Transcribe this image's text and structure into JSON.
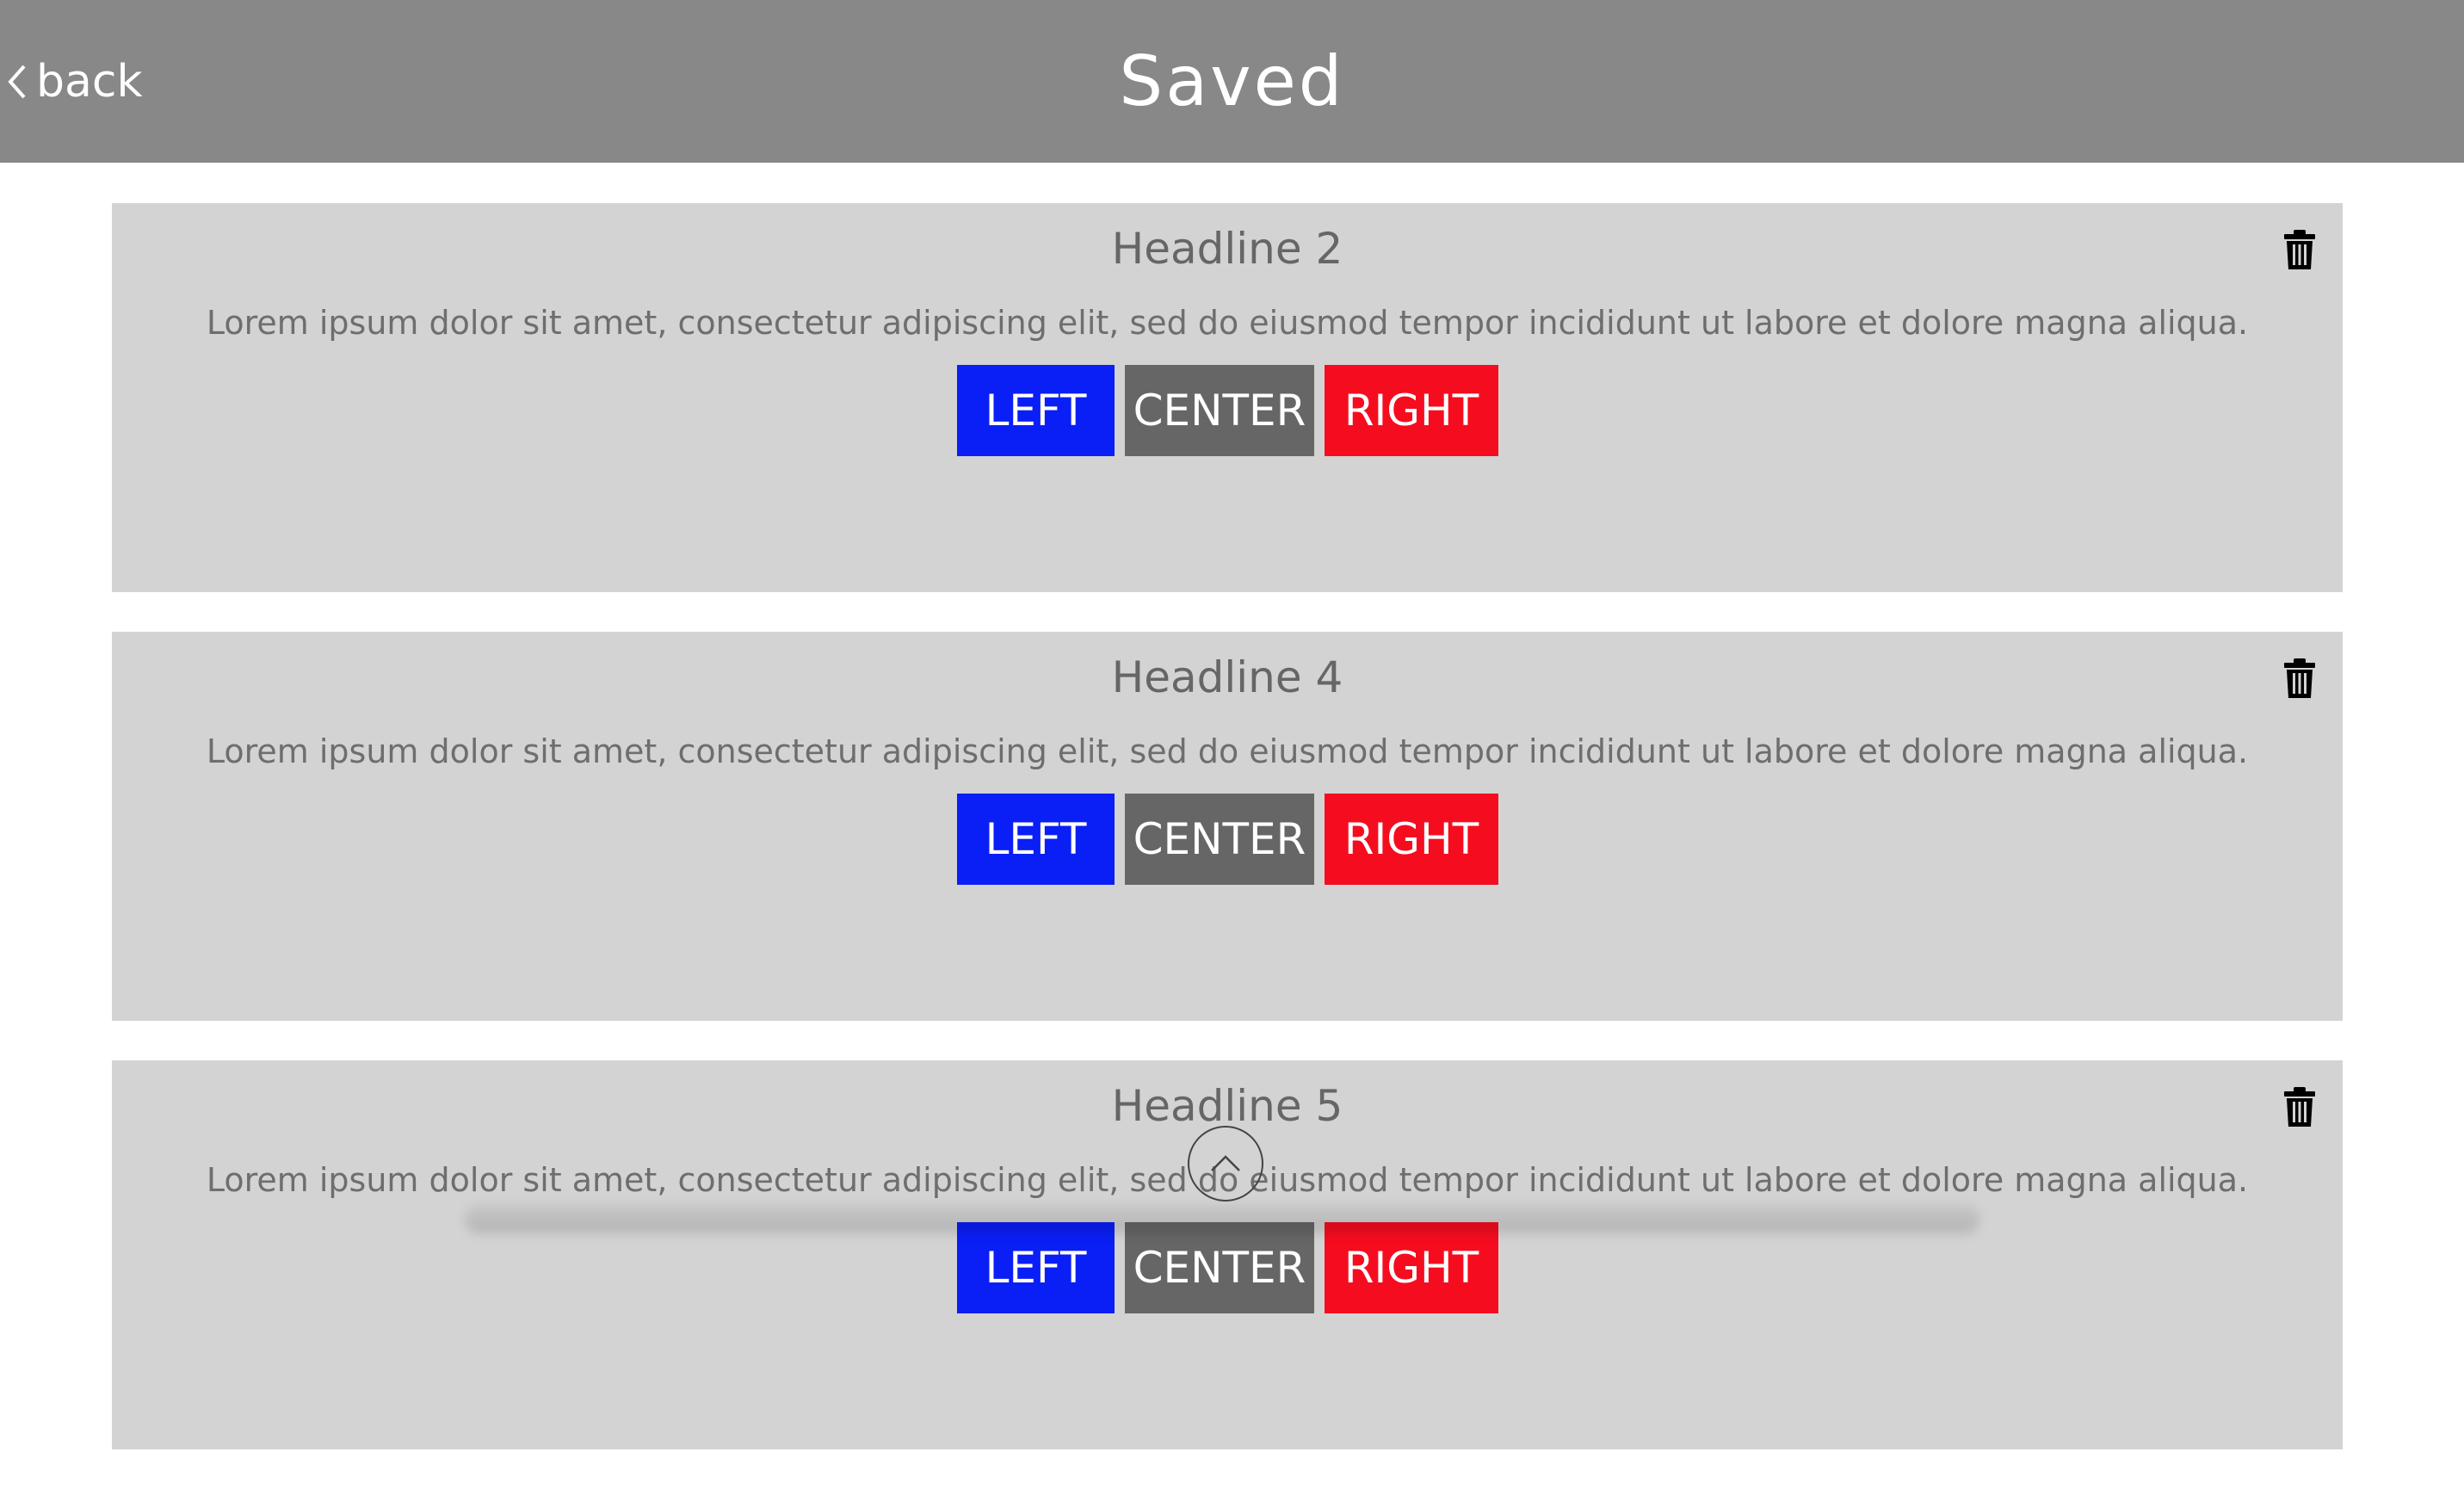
{
  "header": {
    "back_label": "back",
    "title": "Saved"
  },
  "colors": {
    "header_bg": "#888888",
    "card_bg": "#d3d3d3",
    "left_btn": "#0a1ff5",
    "center_btn": "#666666",
    "right_btn": "#f50d1f"
  },
  "cards": [
    {
      "headline": "Headline 2",
      "body": "Lorem ipsum dolor sit amet, consectetur adipiscing elit, sed do eiusmod tempor incididunt ut labore et dolore magna aliqua.",
      "left_label": "LEFT",
      "center_label": "CENTER",
      "right_label": "RIGHT"
    },
    {
      "headline": "Headline 4",
      "body": "Lorem ipsum dolor sit amet, consectetur adipiscing elit, sed do eiusmod tempor incididunt ut labore et dolore magna aliqua.",
      "left_label": "LEFT",
      "center_label": "CENTER",
      "right_label": "RIGHT"
    },
    {
      "headline": "Headline 5",
      "body": "Lorem ipsum dolor sit amet, consectetur adipiscing elit, sed do eiusmod tempor incididunt ut labore et dolore magna aliqua.",
      "left_label": "LEFT",
      "center_label": "CENTER",
      "right_label": "RIGHT"
    }
  ],
  "icons": {
    "back": "chevron-left-icon",
    "delete": "trash-icon",
    "scroll_top": "chevron-up-icon"
  }
}
